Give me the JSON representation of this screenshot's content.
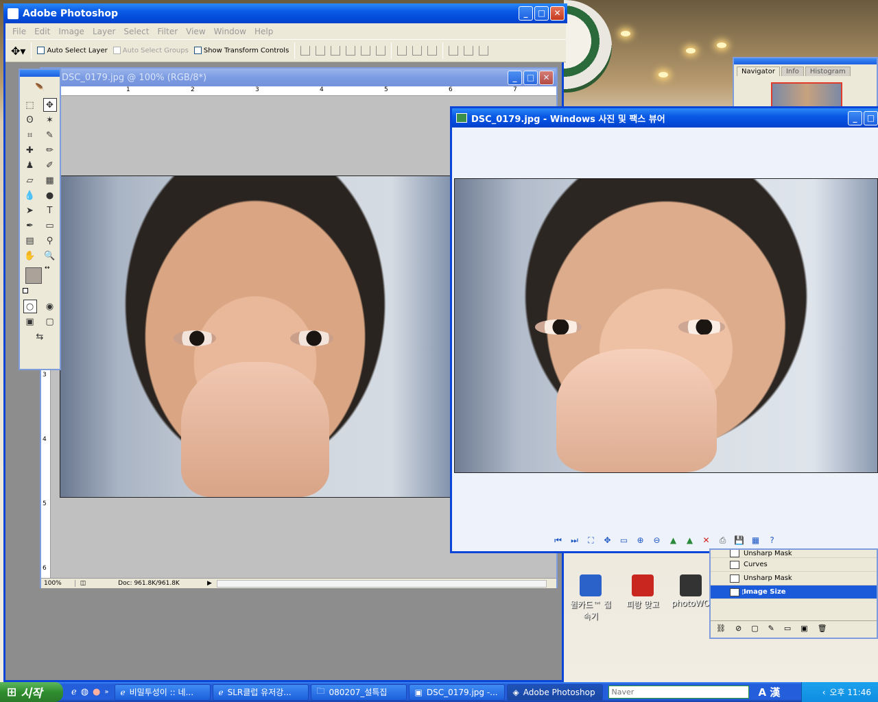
{
  "photoshop": {
    "title": "Adobe Photoshop",
    "menu": [
      "File",
      "Edit",
      "Image",
      "Layer",
      "Select",
      "Filter",
      "View",
      "Window",
      "Help"
    ],
    "options": {
      "auto_select_layer": "Auto Select Layer",
      "auto_select_groups": "Auto Select Groups",
      "show_transform_controls": "Show Transform Controls"
    },
    "document": {
      "title": "DSC_0179.jpg @ 100% (RGB/8*)",
      "zoom": "100%",
      "doc_size": "Doc: 961.8K/961.8K",
      "ruler_h": [
        "1",
        "2",
        "3",
        "4",
        "5",
        "6",
        "7"
      ],
      "ruler_v": [
        "3",
        "4",
        "5",
        "6"
      ]
    },
    "navigator": {
      "tabs": [
        "Navigator",
        "Info",
        "Histogram"
      ]
    },
    "history": {
      "items": [
        "Unsharp Mask",
        "Curves",
        "Unsharp Mask",
        "Image Size"
      ],
      "selected_index": 3
    }
  },
  "viewer": {
    "title": "DSC_0179.jpg - Windows 사진 및 팩스 뷰어"
  },
  "desktop_icons": [
    {
      "label": "윌카드™ 접속기",
      "icon": "network-icon",
      "color": "#2a62c9"
    },
    {
      "label": "피랑 맞고",
      "icon": "vsp-game-icon",
      "color": "#c9261f"
    },
    {
      "label": "photoWO",
      "icon": "camera-icon",
      "color": "#333333"
    }
  ],
  "taskbar": {
    "start_label": "시작",
    "tasks": [
      "비밀투성이 :: 네...",
      "SLR클럽 유저강...",
      "080207_설특집",
      "DSC_0179.jpg -...",
      "Adobe Photoshop"
    ],
    "active_index": 4,
    "search_placeholder": "Naver",
    "ime": "A 漢",
    "clock": "오후 11:46"
  }
}
